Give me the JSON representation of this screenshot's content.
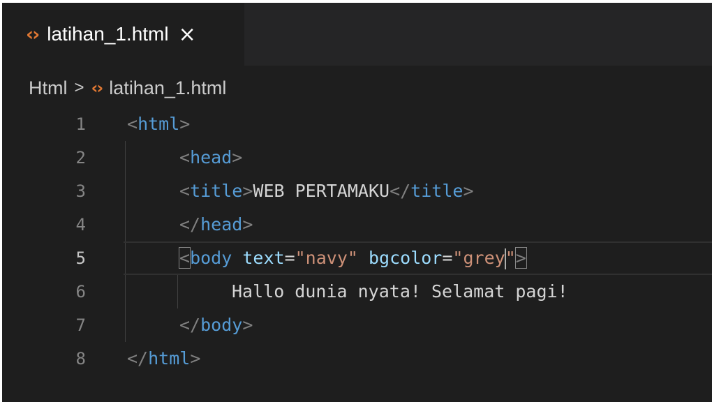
{
  "tab": {
    "label": "latihan_1.html",
    "icon": "html-file-icon",
    "close_glyph": "×"
  },
  "breadcrumb": {
    "folder": "Html",
    "separator": ">",
    "file": "latihan_1.html"
  },
  "editor": {
    "lines": [
      {
        "number": "1"
      },
      {
        "number": "2"
      },
      {
        "number": "3"
      },
      {
        "number": "4"
      },
      {
        "number": "5"
      },
      {
        "number": "6"
      },
      {
        "number": "7"
      },
      {
        "number": "8"
      }
    ],
    "tokens": {
      "lt": "<",
      "gt": ">",
      "lt_slash": "</",
      "html": "html",
      "head": "head",
      "title": "title",
      "title_text": "WEB PERTAMAKU",
      "body": "body",
      "attr_text": "text",
      "eq": "=",
      "val_navy": "\"navy\"",
      "attr_bgcolor": "bgcolor",
      "val_grey_open": "\"grey",
      "quote": "\"",
      "body_text": "Hallo dunia nyata! Selamat pagi!"
    },
    "active_line": "5"
  },
  "colors": {
    "background": "#1e1e1e",
    "tag": "#569cd6",
    "attribute": "#9cdcfe",
    "string": "#ce9178",
    "html_icon": "#e37933"
  }
}
